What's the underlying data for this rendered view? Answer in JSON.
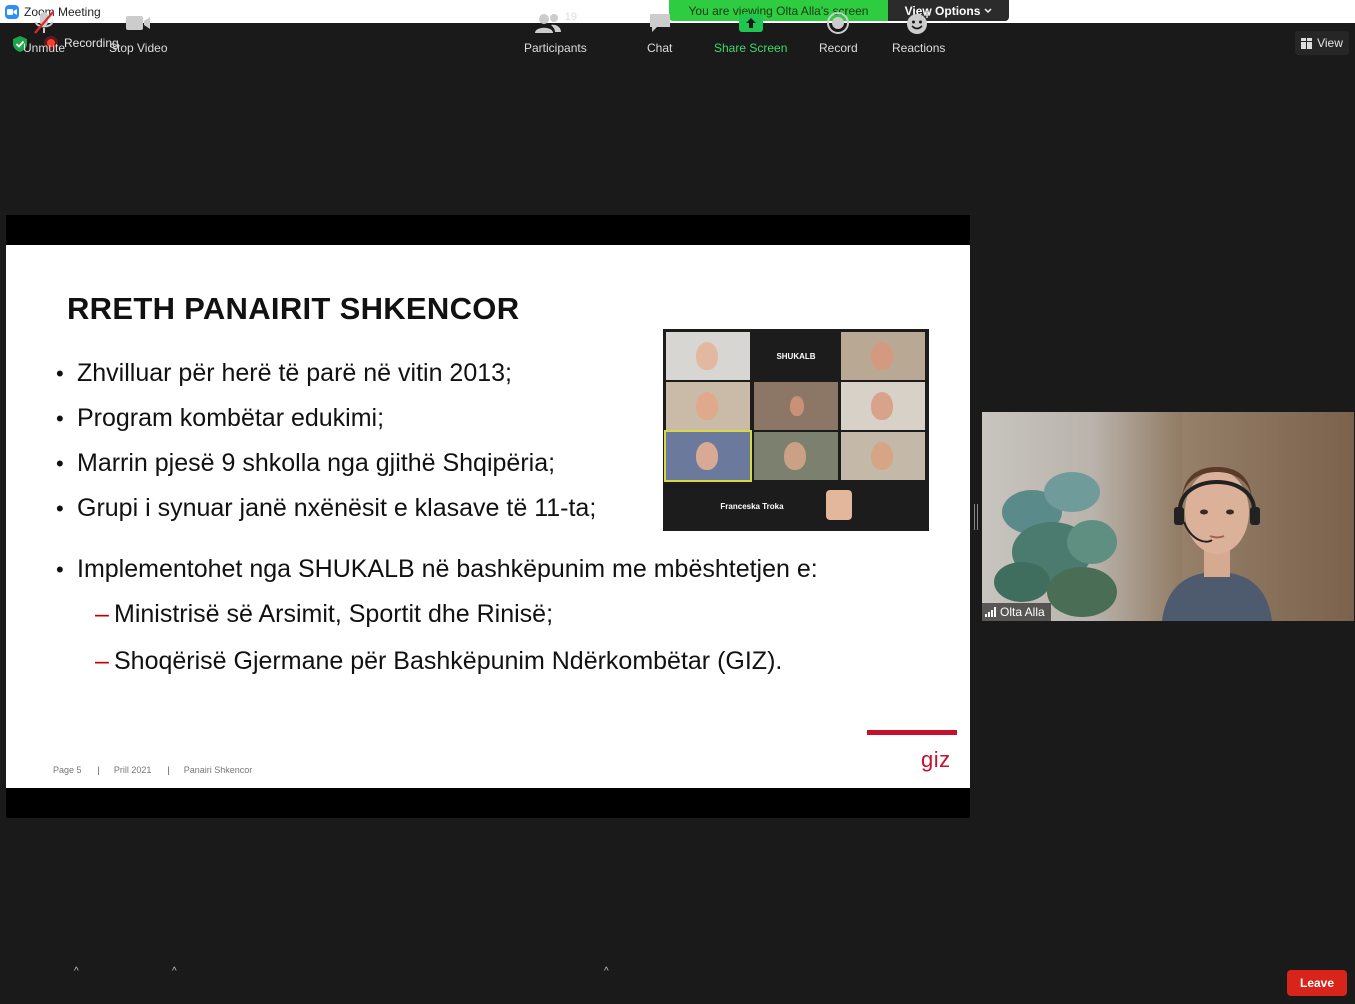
{
  "window": {
    "title": "Zoom Meeting"
  },
  "banner": {
    "viewing_text": "You are viewing Olta Alla's screen",
    "view_options": "View Options"
  },
  "top_bar": {
    "recording": "Recording",
    "view": "View"
  },
  "slide": {
    "heading": "RRETH PANAIRIT SHKENCOR",
    "bullets": [
      "Zhvilluar për herë të parë në vitin 2013;",
      "Program kombëtar edukimi;",
      "Marrin pjesë 9 shkolla nga gjithë Shqipëria;",
      "Grupi i synuar janë nxënësit e klasave të 11-ta;",
      "Implementohet nga SHUKALB në bashkëpunim me mbështetjen e:"
    ],
    "sub_bullets": [
      "Ministrisë së Arsimit, Sportit dhe Rinisë;",
      "Shoqërisë Gjermane për Bashkëpunim Ndërkombëtar (GIZ)."
    ],
    "footer": {
      "page": "Page 5",
      "date": "Prill 2021",
      "event": "Panairi Shkencor"
    },
    "logo_text": "giz",
    "gallery": {
      "center_label": "SHUKALB",
      "bottom_label": "Franceska Troka"
    }
  },
  "video": {
    "participant_name": "Olta Alla"
  },
  "toolbar": {
    "unmute": "Unmute",
    "stop_video": "Stop Video",
    "participants": "Participants",
    "participants_count": "19",
    "chat": "Chat",
    "share_screen": "Share Screen",
    "record": "Record",
    "reactions": "Reactions",
    "leave": "Leave"
  },
  "colors": {
    "zoom_blue": "#2d8cff",
    "banner_green": "#2ecc40",
    "share_green": "#3fd96d",
    "leave_red": "#d9241b",
    "giz_red": "#c8102e"
  }
}
